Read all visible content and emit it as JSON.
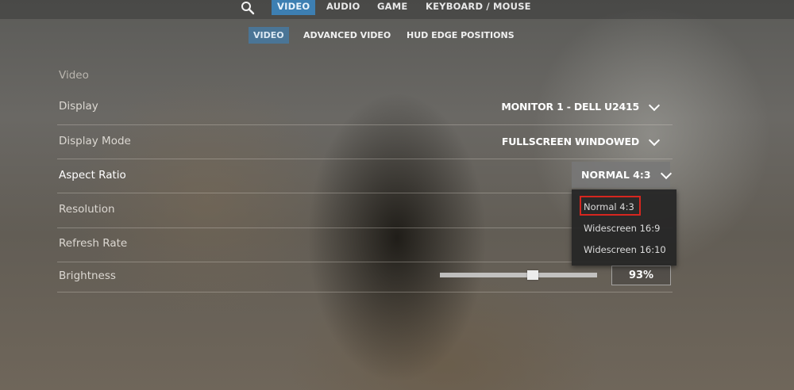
{
  "topnav": {
    "tabs": [
      {
        "label": "VIDEO",
        "active": true
      },
      {
        "label": "AUDIO",
        "active": false
      },
      {
        "label": "GAME",
        "active": false
      },
      {
        "label": "KEYBOARD / MOUSE",
        "active": false
      }
    ]
  },
  "subnav": {
    "tabs": [
      {
        "label": "VIDEO",
        "active": true
      },
      {
        "label": "ADVANCED VIDEO",
        "active": false
      },
      {
        "label": "HUD EDGE POSITIONS",
        "active": false
      }
    ]
  },
  "settings": {
    "section_title": "Video",
    "rows": [
      {
        "label": "Display",
        "value": "MONITOR 1 - DELL U2415"
      },
      {
        "label": "Display Mode",
        "value": "FULLSCREEN WINDOWED"
      },
      {
        "label": "Aspect Ratio",
        "value": "NORMAL 4:3"
      },
      {
        "label": "Resolution",
        "value": ""
      },
      {
        "label": "Refresh Rate",
        "value": ""
      },
      {
        "label": "Brightness",
        "value": "93%"
      }
    ]
  },
  "aspect_dropdown": {
    "options": [
      "Normal 4:3",
      "Widescreen 16:9",
      "Widescreen 16:10"
    ],
    "selected_index": 0
  },
  "brightness": {
    "level_percent": 93,
    "slider_fill_fraction": 0.59
  },
  "colors": {
    "active_tab": "#3d7fb2",
    "active_subtab": "#4a7596",
    "highlight": "#d6261f"
  }
}
